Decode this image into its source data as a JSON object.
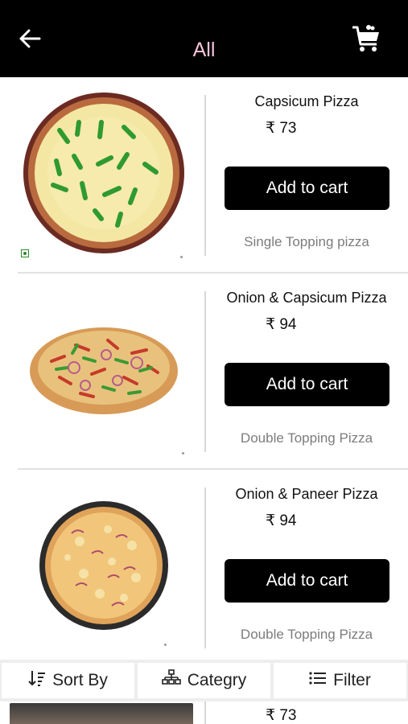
{
  "header": {
    "title": "All",
    "back_icon": "arrow-left-icon",
    "cart_icon": "shopping-cart-icon",
    "background": "#000000",
    "title_color": "#f7c3d8"
  },
  "products": [
    {
      "name": "Capsicum Pizza",
      "price": "₹ 73",
      "button_label": "Add to cart",
      "category": "Single Topping pizza"
    },
    {
      "name": "Onion & Capsicum Pizza",
      "price": "₹ 94",
      "button_label": "Add to cart",
      "category": "Double Topping Pizza"
    },
    {
      "name": "Onion & Paneer Pizza",
      "price": "₹ 94",
      "button_label": "Add to cart",
      "category": "Double Topping Pizza"
    }
  ],
  "bottom_bar": {
    "sort_label": "Sort By",
    "category_label": "Categry",
    "filter_label": "Filter"
  },
  "peek_item": {
    "price": "₹ 73"
  }
}
